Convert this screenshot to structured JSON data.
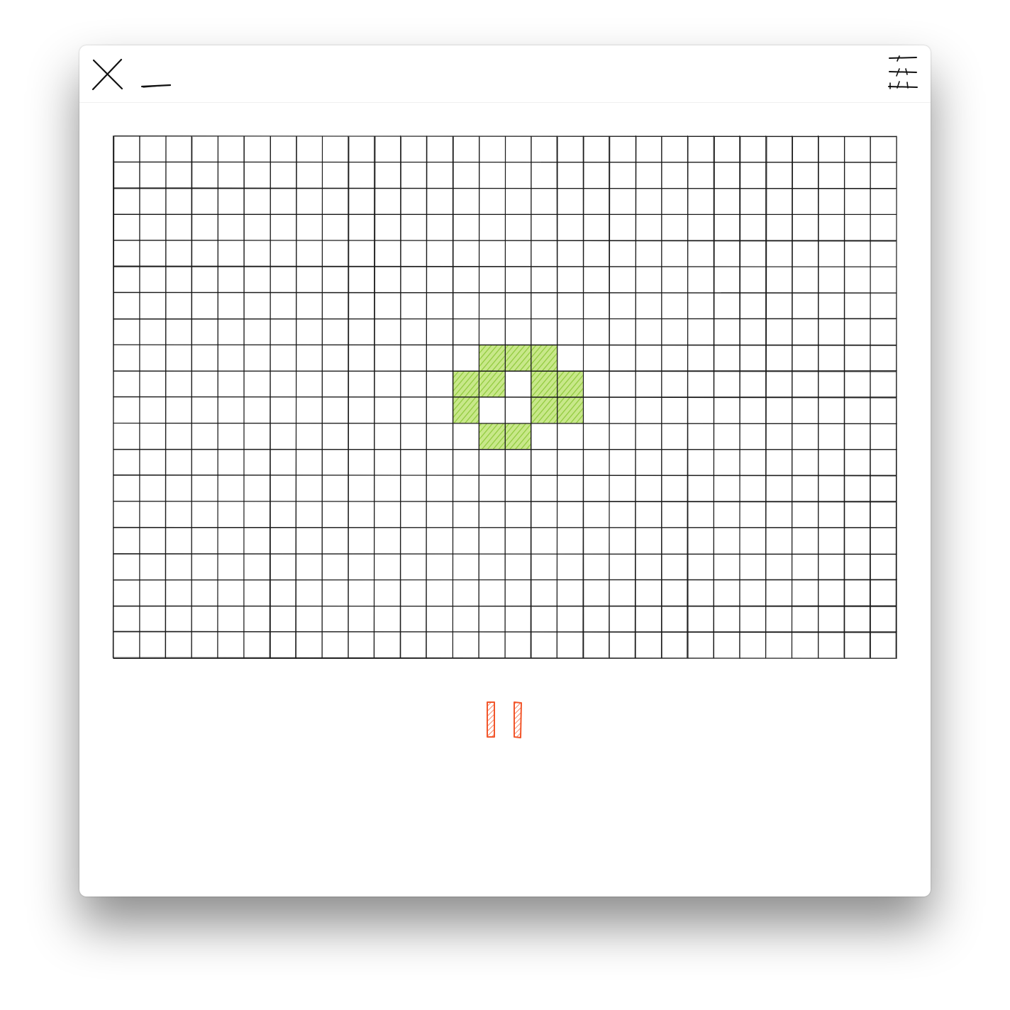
{
  "window": {
    "close_icon": "close-icon",
    "minimize_icon": "minimize-icon",
    "menu_icon": "menu-icon"
  },
  "game": {
    "name": "game-of-life",
    "columns": 30,
    "rows": 20,
    "live_color": "#a6d64a",
    "grid_color": "#1a1a1a",
    "live_cells": [
      {
        "col": 14,
        "row": 8
      },
      {
        "col": 15,
        "row": 8
      },
      {
        "col": 16,
        "row": 8
      },
      {
        "col": 13,
        "row": 9
      },
      {
        "col": 14,
        "row": 9
      },
      {
        "col": 16,
        "row": 9
      },
      {
        "col": 17,
        "row": 9
      },
      {
        "col": 13,
        "row": 10
      },
      {
        "col": 16,
        "row": 10
      },
      {
        "col": 17,
        "row": 10
      },
      {
        "col": 14,
        "row": 11
      },
      {
        "col": 15,
        "row": 11
      }
    ]
  },
  "controls": {
    "pause_icon": "pause-icon",
    "pause_color": "#f2562b",
    "state": "running"
  }
}
